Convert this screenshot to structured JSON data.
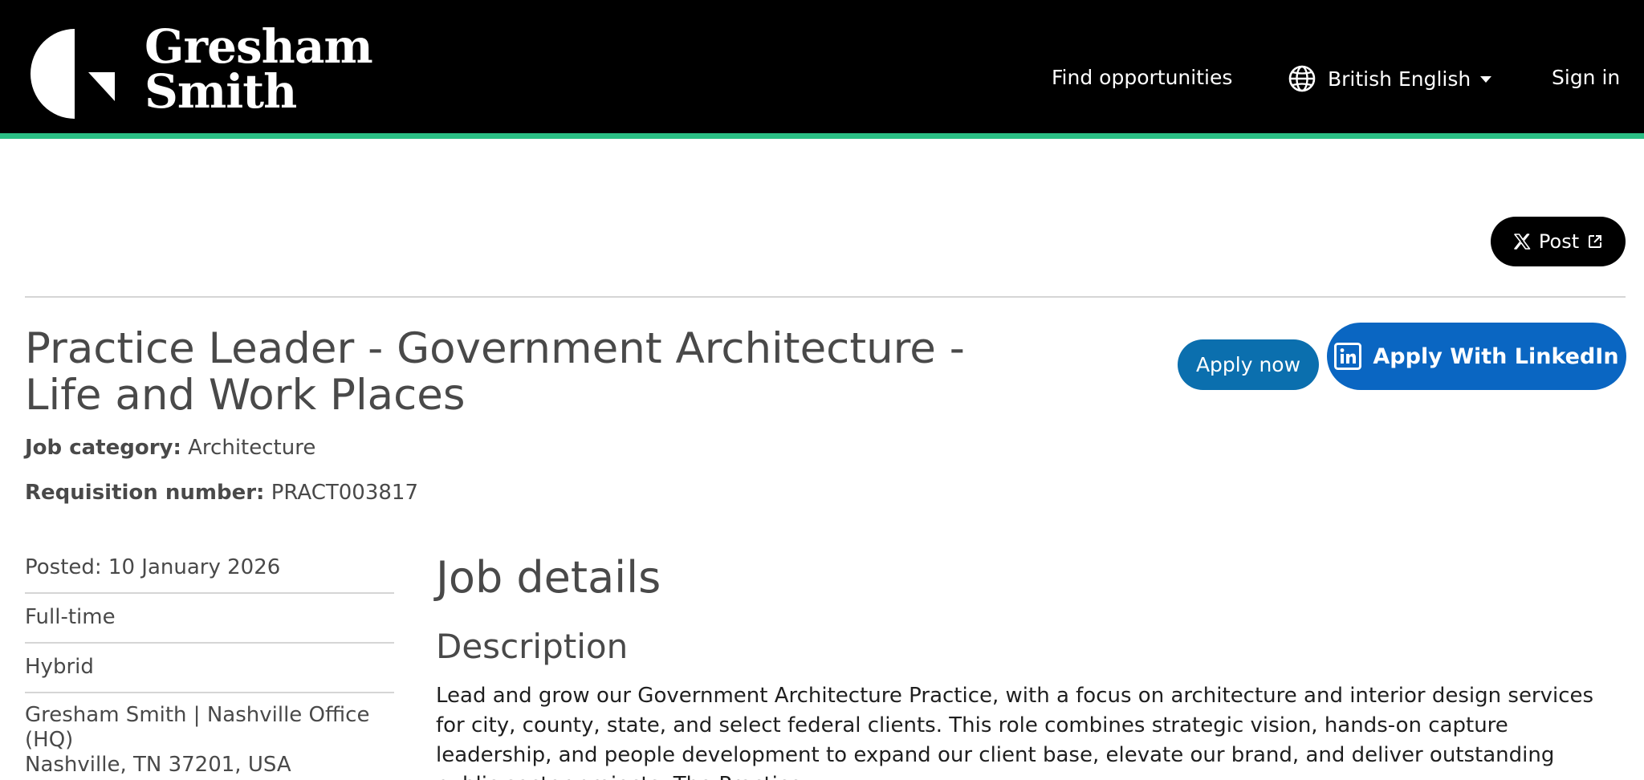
{
  "header": {
    "brand_line1": "Gresham",
    "brand_line2": "Smith",
    "nav_find": "Find opportunities",
    "nav_language": "British English",
    "nav_signin": "Sign in",
    "accent_color": "#2bbf85"
  },
  "share": {
    "post_label": "Post"
  },
  "job": {
    "title": "Practice Leader - Government Architecture - Life and Work Places",
    "category_label": "Job category:",
    "category_value": "Architecture",
    "requisition_label": "Requisition number:",
    "requisition_value": "PRACT003817",
    "apply_label": "Apply now",
    "linkedin_label": "Apply With LinkedIn"
  },
  "sidebar": {
    "posted": "Posted: 10 January 2026",
    "type": "Full-time",
    "workplace": "Hybrid",
    "location_line1": "Gresham Smith | Nashville Office (HQ)",
    "location_line2": "Nashville, TN 37201, USA"
  },
  "main": {
    "details_heading": "Job details",
    "description_heading": "Description",
    "description_text": "Lead and grow our Government Architecture Practice, with a focus on architecture and interior design services for city, county, state, and select federal clients. This role combines strategic vision, hands-on capture leadership, and people development to expand our client base, elevate our brand, and deliver outstanding public sector projects. The Practice"
  }
}
